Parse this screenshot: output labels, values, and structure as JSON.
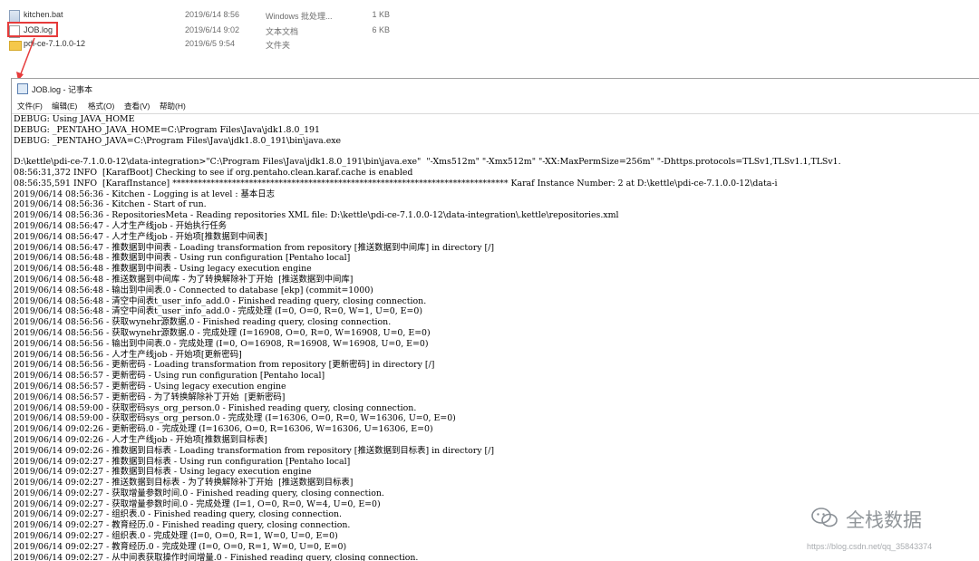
{
  "explorer": {
    "files": [
      {
        "name": "kitchen.bat",
        "date": "2019/6/14 8:56",
        "type": "Windows 批处理...",
        "size": "1 KB",
        "icon": "batch-file-icon"
      },
      {
        "name": "JOB.log",
        "date": "2019/6/14 9:02",
        "type": "文本文档",
        "size": "6 KB",
        "icon": "text-file-icon"
      },
      {
        "name": "pdi-ce-7.1.0.0-12",
        "date": "2019/6/5 9:54",
        "type": "文件夹",
        "size": "",
        "icon": "folder-icon"
      }
    ],
    "highlight_color": "#e63b3b"
  },
  "notepad": {
    "title": "JOB.log - 记事本",
    "menu": [
      "文件(F)",
      "编辑(E)",
      "格式(O)",
      "查看(V)",
      "帮助(H)"
    ],
    "lines": [
      "DEBUG: Using JAVA_HOME",
      "DEBUG: _PENTAHO_JAVA_HOME=C:\\Program Files\\Java\\jdk1.8.0_191",
      "DEBUG: _PENTAHO_JAVA=C:\\Program Files\\Java\\jdk1.8.0_191\\bin\\java.exe",
      "",
      "D:\\kettle\\pdi-ce-7.1.0.0-12\\data-integration>\"C:\\Program Files\\Java\\jdk1.8.0_191\\bin\\java.exe\"  \"-Xms512m\" \"-Xmx512m\" \"-XX:MaxPermSize=256m\" \"-Dhttps.protocols=TLSv1,TLSv1.1,TLSv1.",
      "08:56:31,372 INFO  [KarafBoot] Checking to see if org.pentaho.clean.karaf.cache is enabled",
      "08:56:35,591 INFO  [KarafInstance] ******************************************************************************* Karaf Instance Number: 2 at D:\\kettle\\pdi-ce-7.1.0.0-12\\data-i",
      "2019/06/14 08:56:36 - Kitchen - Logging is at level : 基本日志",
      "2019/06/14 08:56:36 - Kitchen - Start of run.",
      "2019/06/14 08:56:36 - RepositoriesMeta - Reading repositories XML file: D:\\kettle\\pdi-ce-7.1.0.0-12\\data-integration\\.kettle\\repositories.xml",
      "2019/06/14 08:56:47 - 人才生产线job - 开始执行任务",
      "2019/06/14 08:56:47 - 人才生产线job - 开始项[推数据到中间表]",
      "2019/06/14 08:56:47 - 推数据到中间表 - Loading transformation from repository [推送数据到中间库] in directory [/]",
      "2019/06/14 08:56:48 - 推数据到中间表 - Using run configuration [Pentaho local]",
      "2019/06/14 08:56:48 - 推数据到中间表 - Using legacy execution engine",
      "2019/06/14 08:56:48 - 推送数据到中间库 - 为了转换解除补丁开始  [推送数据到中间库]",
      "2019/06/14 08:56:48 - 输出到中间表.0 - Connected to database [ekp] (commit=1000)",
      "2019/06/14 08:56:48 - 清空中间表t_user_info_add.0 - Finished reading query, closing connection.",
      "2019/06/14 08:56:48 - 清空中间表t_user_info_add.0 - 完成处理 (I=0, O=0, R=0, W=1, U=0, E=0)",
      "2019/06/14 08:56:56 - 获取wynehr源数据.0 - Finished reading query, closing connection.",
      "2019/06/14 08:56:56 - 获取wynehr源数据.0 - 完成处理 (I=16908, O=0, R=0, W=16908, U=0, E=0)",
      "2019/06/14 08:56:56 - 输出到中间表.0 - 完成处理 (I=0, O=16908, R=16908, W=16908, U=0, E=0)",
      "2019/06/14 08:56:56 - 人才生产线job - 开始项[更新密码]",
      "2019/06/14 08:56:56 - 更新密码 - Loading transformation from repository [更新密码] in directory [/]",
      "2019/06/14 08:56:57 - 更新密码 - Using run configuration [Pentaho local]",
      "2019/06/14 08:56:57 - 更新密码 - Using legacy execution engine",
      "2019/06/14 08:56:57 - 更新密码 - 为了转换解除补丁开始  [更新密码]",
      "2019/06/14 08:59:00 - 获取密码sys_org_person.0 - Finished reading query, closing connection.",
      "2019/06/14 08:59:00 - 获取密码sys_org_person.0 - 完成处理 (I=16306, O=0, R=0, W=16306, U=0, E=0)",
      "2019/06/14 09:02:26 - 更新密码.0 - 完成处理 (I=16306, O=0, R=16306, W=16306, U=16306, E=0)",
      "2019/06/14 09:02:26 - 人才生产线job - 开始项[推数据到目标表]",
      "2019/06/14 09:02:26 - 推数据到目标表 - Loading transformation from repository [推送数据到目标表] in directory [/]",
      "2019/06/14 09:02:27 - 推数据到目标表 - Using run configuration [Pentaho local]",
      "2019/06/14 09:02:27 - 推数据到目标表 - Using legacy execution engine",
      "2019/06/14 09:02:27 - 推送数据到目标表 - 为了转换解除补丁开始  [推送数据到目标表]",
      "2019/06/14 09:02:27 - 获取增量参数时间.0 - Finished reading query, closing connection.",
      "2019/06/14 09:02:27 - 获取增量参数时间.0 - 完成处理 (I=1, O=0, R=0, W=4, U=0, E=0)",
      "2019/06/14 09:02:27 - 组织表.0 - Finished reading query, closing connection.",
      "2019/06/14 09:02:27 - 教育经历.0 - Finished reading query, closing connection.",
      "2019/06/14 09:02:27 - 组织表.0 - 完成处理 (I=0, O=0, R=1, W=0, U=0, E=0)",
      "2019/06/14 09:02:27 - 教育经历.0 - 完成处理 (I=0, O=0, R=1, W=0, U=0, E=0)",
      "2019/06/14 09:02:27 - 从中间表获取操作时间增量.0 - Finished reading query, closing connection."
    ]
  },
  "watermark": {
    "text": "全栈数据",
    "icon": "wechat-icon",
    "url": "https://blog.csdn.net/qq_35843374"
  }
}
